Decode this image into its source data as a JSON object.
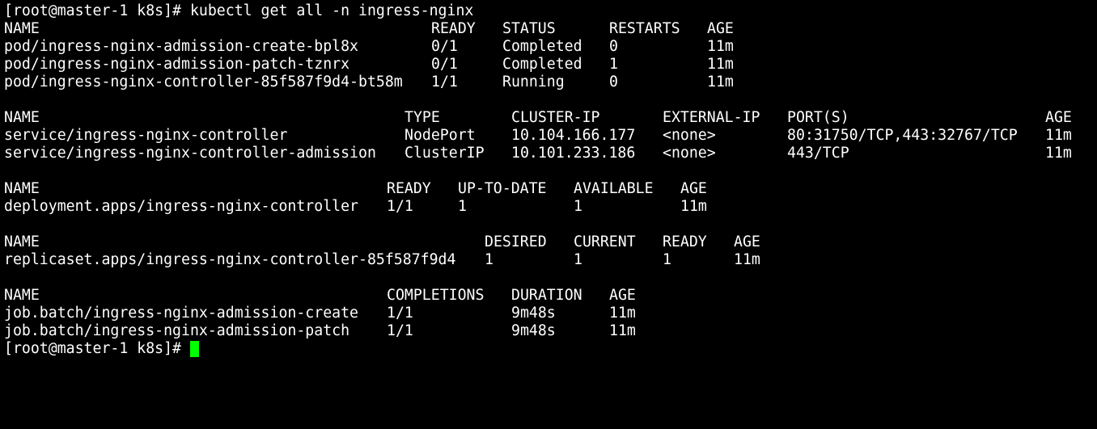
{
  "terminal": {
    "prompt": "[root@master-1 k8s]# ",
    "command": "kubectl get all -n ingress-nginx",
    "cursor_color": "#00ff00",
    "background_color": "#000000",
    "text_color": "#ffffff"
  },
  "pods": {
    "headers": [
      "NAME",
      "READY",
      "STATUS",
      "RESTARTS",
      "AGE"
    ],
    "rows": [
      [
        "pod/ingress-nginx-admission-create-bpl8x",
        "0/1",
        "Completed",
        "0",
        "11m"
      ],
      [
        "pod/ingress-nginx-admission-patch-tznrx",
        "0/1",
        "Completed",
        "1",
        "11m"
      ],
      [
        "pod/ingress-nginx-controller-85f587f9d4-bt58m",
        "1/1",
        "Running",
        "0",
        "11m"
      ]
    ]
  },
  "services": {
    "headers": [
      "NAME",
      "TYPE",
      "CLUSTER-IP",
      "EXTERNAL-IP",
      "PORT(S)",
      "AGE"
    ],
    "rows": [
      [
        "service/ingress-nginx-controller",
        "NodePort",
        "10.104.166.177",
        "<none>",
        "80:31750/TCP,443:32767/TCP",
        "11m"
      ],
      [
        "service/ingress-nginx-controller-admission",
        "ClusterIP",
        "10.101.233.186",
        "<none>",
        "443/TCP",
        "11m"
      ]
    ]
  },
  "deployments": {
    "headers": [
      "NAME",
      "READY",
      "UP-TO-DATE",
      "AVAILABLE",
      "AGE"
    ],
    "rows": [
      [
        "deployment.apps/ingress-nginx-controller",
        "1/1",
        "1",
        "1",
        "11m"
      ]
    ]
  },
  "replicasets": {
    "headers": [
      "NAME",
      "DESIRED",
      "CURRENT",
      "READY",
      "AGE"
    ],
    "rows": [
      [
        "replicaset.apps/ingress-nginx-controller-85f587f9d4",
        "1",
        "1",
        "1",
        "11m"
      ]
    ]
  },
  "jobs": {
    "headers": [
      "NAME",
      "COMPLETIONS",
      "DURATION",
      "AGE"
    ],
    "rows": [
      [
        "job.batch/ingress-nginx-admission-create",
        "1/1",
        "9m48s",
        "11m"
      ],
      [
        "job.batch/ingress-nginx-admission-patch",
        "1/1",
        "9m48s",
        "11m"
      ]
    ]
  }
}
